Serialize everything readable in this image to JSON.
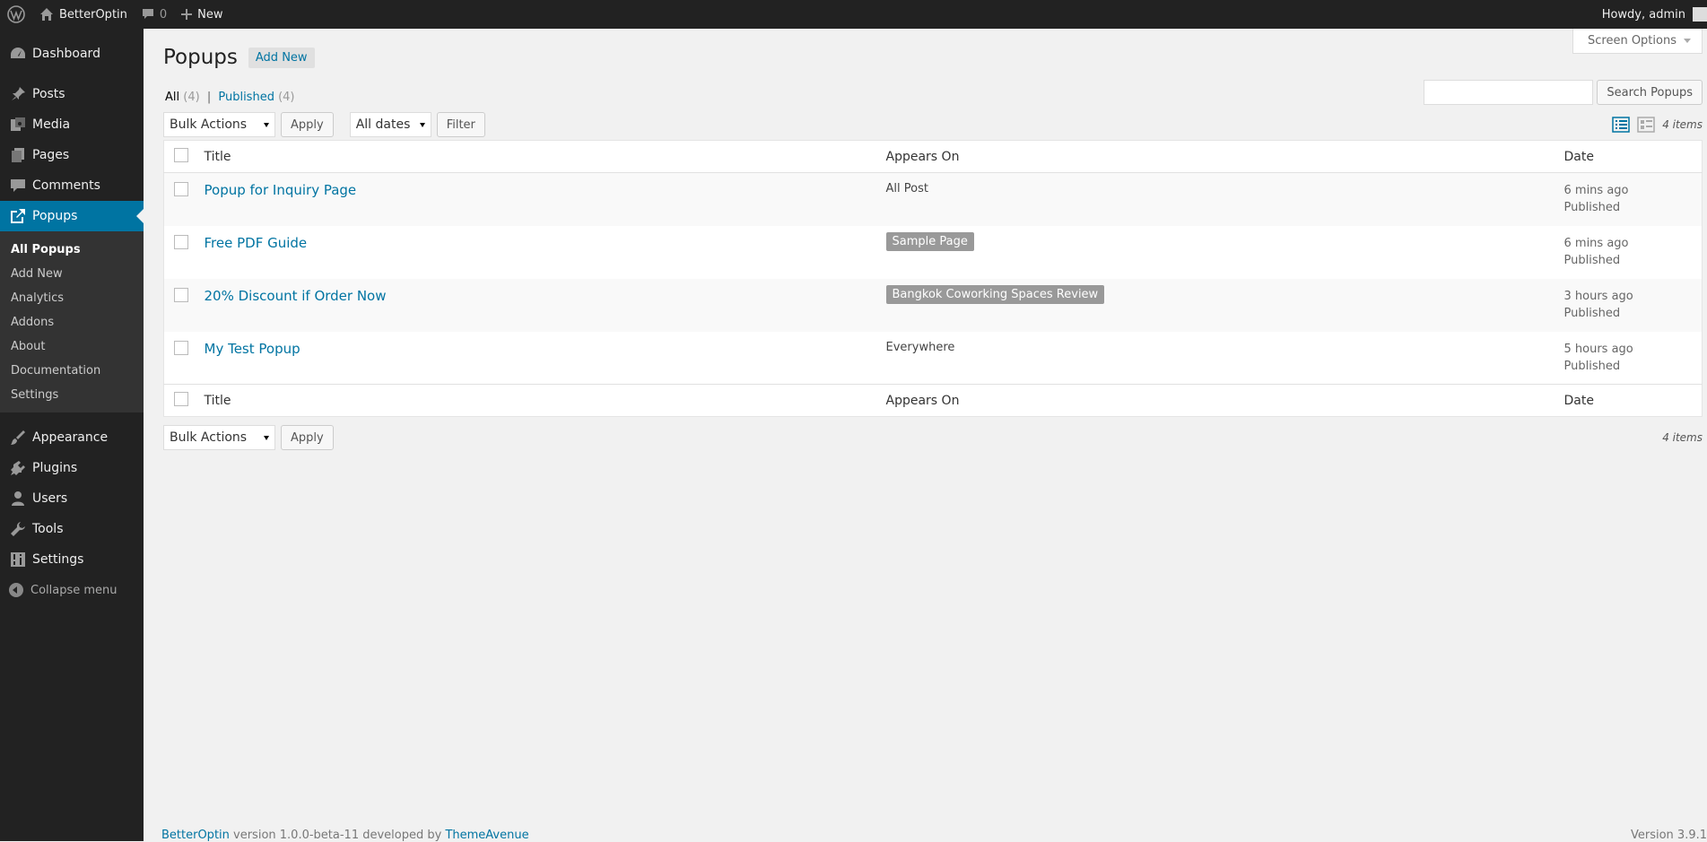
{
  "adminbar": {
    "site_name": "BetterOptin",
    "comments_count": "0",
    "new_label": "New",
    "howdy": "Howdy, admin"
  },
  "sidebar": {
    "items": [
      {
        "label": "Dashboard",
        "icon": "dashboard-icon"
      },
      {
        "label": "Posts",
        "icon": "pin-icon"
      },
      {
        "label": "Media",
        "icon": "media-icon"
      },
      {
        "label": "Pages",
        "icon": "pages-icon"
      },
      {
        "label": "Comments",
        "icon": "comment-icon"
      },
      {
        "label": "Popups",
        "icon": "popup-icon"
      }
    ],
    "submenu": [
      "All Popups",
      "Add New",
      "Analytics",
      "Addons",
      "About",
      "Documentation",
      "Settings"
    ],
    "items2": [
      {
        "label": "Appearance",
        "icon": "brush-icon"
      },
      {
        "label": "Plugins",
        "icon": "plug-icon"
      },
      {
        "label": "Users",
        "icon": "user-icon"
      },
      {
        "label": "Tools",
        "icon": "wrench-icon"
      },
      {
        "label": "Settings",
        "icon": "settings-icon"
      }
    ],
    "collapse": "Collapse menu"
  },
  "page": {
    "title": "Popups",
    "add_new": "Add New",
    "screen_options": "Screen Options",
    "filter_all": "All",
    "filter_all_count": "(4)",
    "filter_sep": "|",
    "filter_published": "Published",
    "filter_published_count": "(4)",
    "search_button": "Search Popups",
    "bulk_actions": "Bulk Actions",
    "apply": "Apply",
    "all_dates": "All dates",
    "filter": "Filter",
    "items_count": "4 items"
  },
  "table": {
    "headers": {
      "title": "Title",
      "appears_on": "Appears On",
      "date": "Date"
    },
    "rows": [
      {
        "title": "Popup for Inquiry Page",
        "appears_on": "All Post",
        "appears_tag": false,
        "date": "6 mins ago",
        "status": "Published"
      },
      {
        "title": "Free PDF Guide",
        "appears_on": "Sample Page",
        "appears_tag": true,
        "date": "6 mins ago",
        "status": "Published"
      },
      {
        "title": "20% Discount if Order Now",
        "appears_on": "Bangkok Coworking Spaces Review",
        "appears_tag": true,
        "date": "3 hours ago",
        "status": "Published"
      },
      {
        "title": "My Test Popup",
        "appears_on": "Everywhere",
        "appears_tag": false,
        "date": "5 hours ago",
        "status": "Published"
      }
    ]
  },
  "footer": {
    "link1": "BetterOptin",
    "text": " version 1.0.0-beta-11 developed by ",
    "link2": "ThemeAvenue",
    "version": "Version 3.9.1"
  }
}
